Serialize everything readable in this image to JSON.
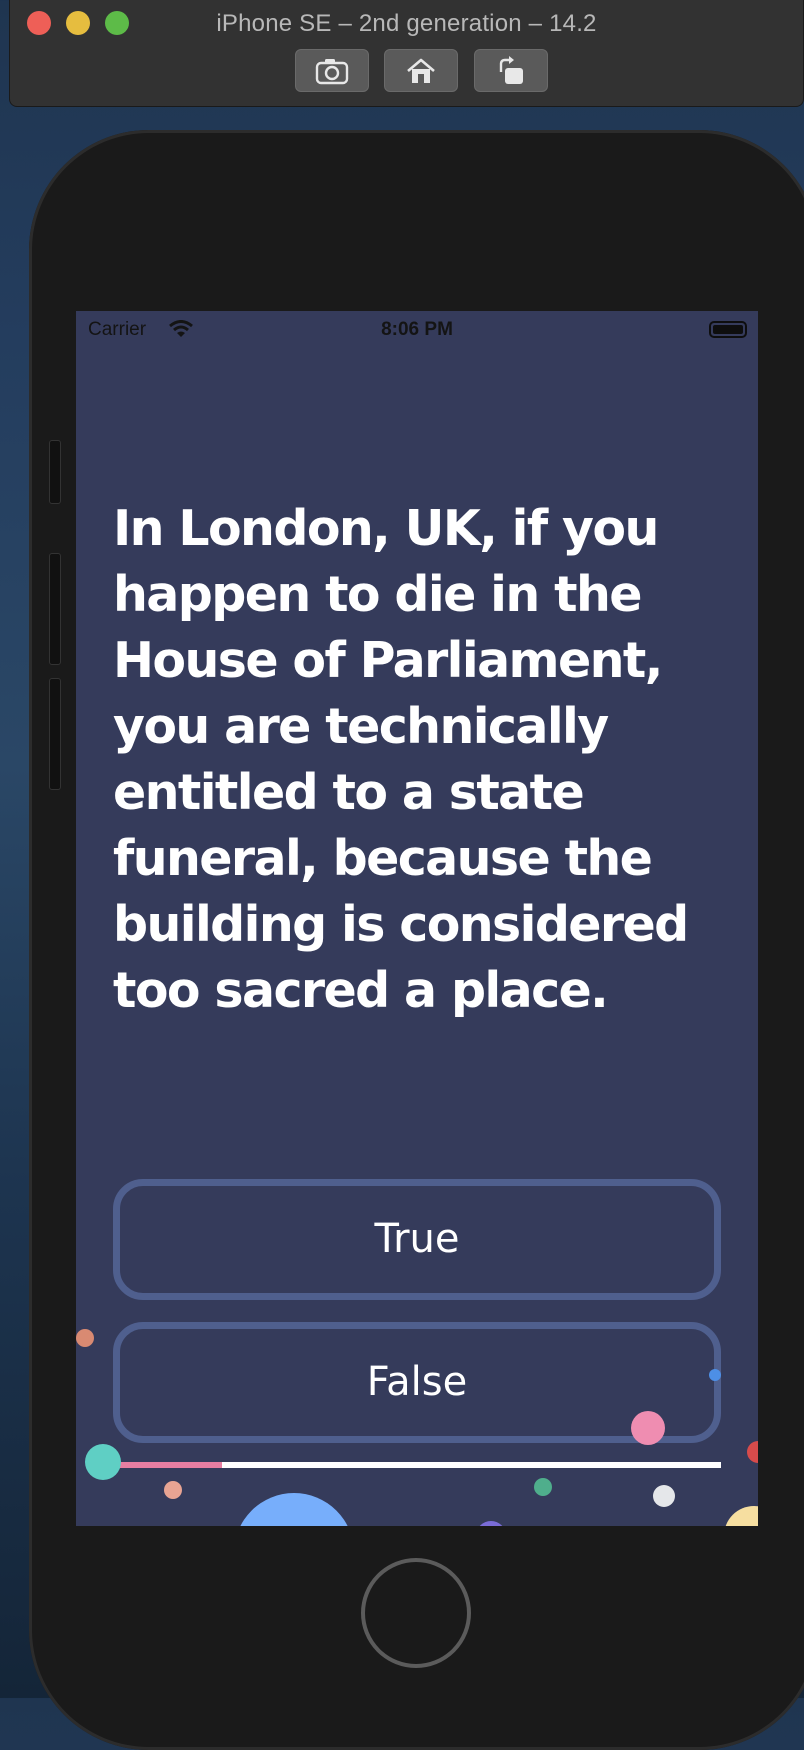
{
  "window": {
    "title": "iPhone SE – 2nd generation – 14.2",
    "toolbar": [
      "screenshot-icon",
      "home-icon",
      "rotate-icon"
    ]
  },
  "status_bar": {
    "carrier": "Carrier",
    "time": "8:06 PM"
  },
  "quiz": {
    "question": "In London, UK, if you happen to die in the House of Parliament, you are technically entitled to a state funeral, because the building is considered too sacred a place.",
    "answer_true": "True",
    "answer_false": "False",
    "progress": 0.18
  },
  "colors": {
    "screen_background": "#353b5b",
    "button_border": "#4f5f8e",
    "progress_fill": "#e87ea2",
    "progress_track": "#ffffff"
  }
}
